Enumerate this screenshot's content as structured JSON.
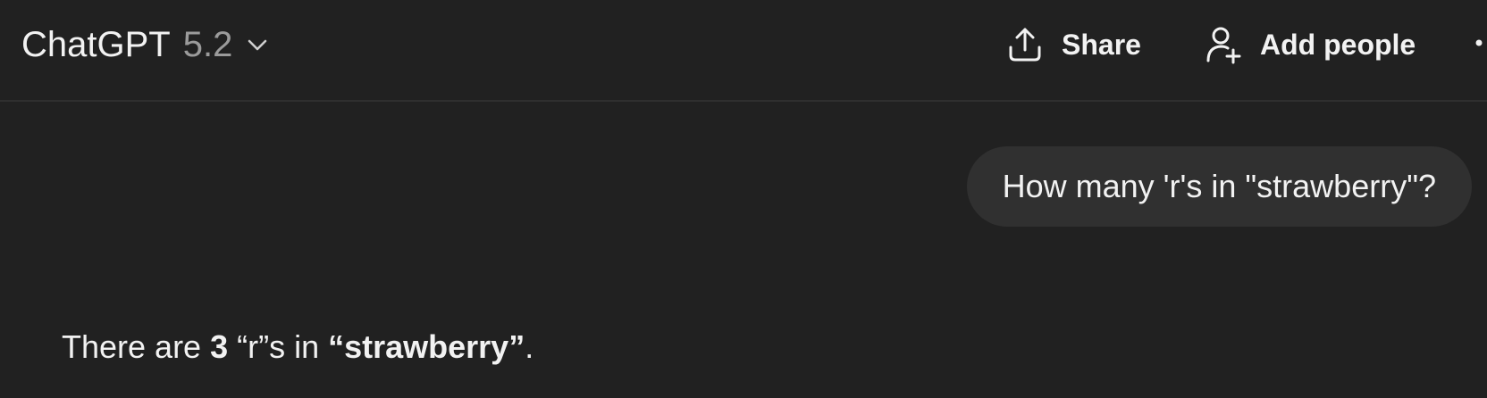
{
  "header": {
    "model_name": "ChatGPT",
    "model_version": "5.2",
    "model_dropdown_icon": "chevron-down-icon",
    "share": {
      "label": "Share",
      "icon": "share-upload-icon"
    },
    "add_people": {
      "label": "Add people",
      "icon": "add-person-icon"
    },
    "more": {
      "icon": "more-options-icon"
    }
  },
  "conversation": {
    "user_message": "How many 'r's in \"strawberry\"?",
    "assistant_message": {
      "prefix": "There are ",
      "count": "3",
      "middle": " “r”s in ",
      "word": "“strawberry”",
      "suffix": "."
    }
  },
  "colors": {
    "background": "#212121",
    "user_bubble": "#303030",
    "text": "#f2f2f2",
    "muted_text": "#9b9b9b",
    "divider": "#2f2f2f"
  }
}
